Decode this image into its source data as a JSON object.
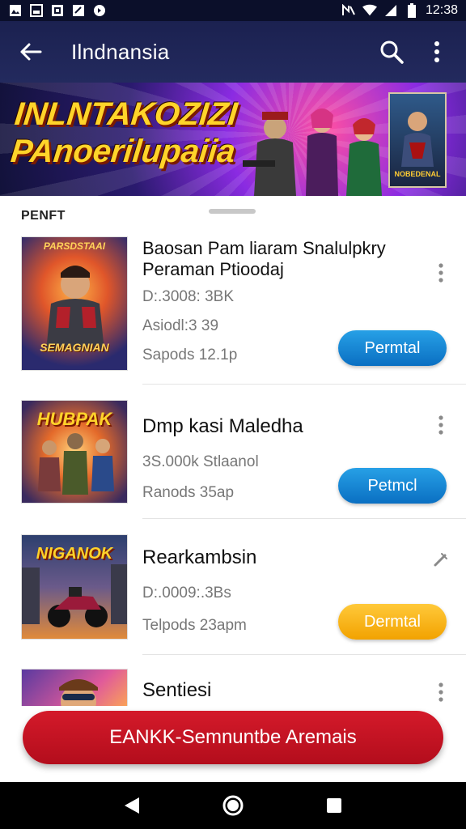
{
  "status_bar": {
    "time": "12:38",
    "left_icons": [
      "photo-icon",
      "image-icon",
      "gallery-icon",
      "document-icon",
      "chat-icon"
    ],
    "right_icons": [
      "nfc-icon",
      "wifi-icon",
      "signal-icon",
      "battery-icon"
    ]
  },
  "app_bar": {
    "title": "Ilndnansia",
    "icons": [
      "back-arrow-icon",
      "search-icon",
      "more-vert-icon"
    ]
  },
  "banner": {
    "headline_line1": "INLNTAKOZIZI",
    "headline_line2": "PAnoerilupaiia",
    "cover_label": "NOBEDENAL"
  },
  "section_label": "PENFT",
  "list": [
    {
      "title": "Baosan Pam liaram Snalulpkry Peraman Ptioodaj",
      "meta1": "D:.3008: 3BK",
      "meta2": "Asiodl:3 39",
      "meta3": "Sapods 12.1p",
      "button": "Permtal",
      "button_color": "#0a6fc2",
      "thumb_title": "SEMAGNIAN",
      "thumb_top": "PARSDSTAAI",
      "menu_icon": "more-vert-icon"
    },
    {
      "title": "Dmp kasi Maledha",
      "meta1": "3S.000k Stlaanol",
      "meta2": "Ranods 35ap",
      "button": "Petmcl",
      "button_color": "#0a6fc2",
      "thumb_title": "HUBPAK",
      "menu_icon": "more-vert-icon"
    },
    {
      "title": "Rearkambsin",
      "meta1": "D:.0009:.3Bs",
      "meta2": "Telpods 23apm",
      "button": "Dermtal",
      "button_color": "#f2a200",
      "thumb_title": "NIGANOK",
      "menu_icon": "edit-pencil-icon"
    },
    {
      "title": "Sentiesi",
      "thumb_title": "",
      "menu_icon": "more-vert-icon"
    }
  ],
  "cta": {
    "label": "EANKK-Semnuntbe Aremais",
    "color": "#c8102e"
  },
  "nav_bar": {
    "icons": [
      "back-triangle-icon",
      "home-circle-icon",
      "recents-square-icon"
    ]
  }
}
